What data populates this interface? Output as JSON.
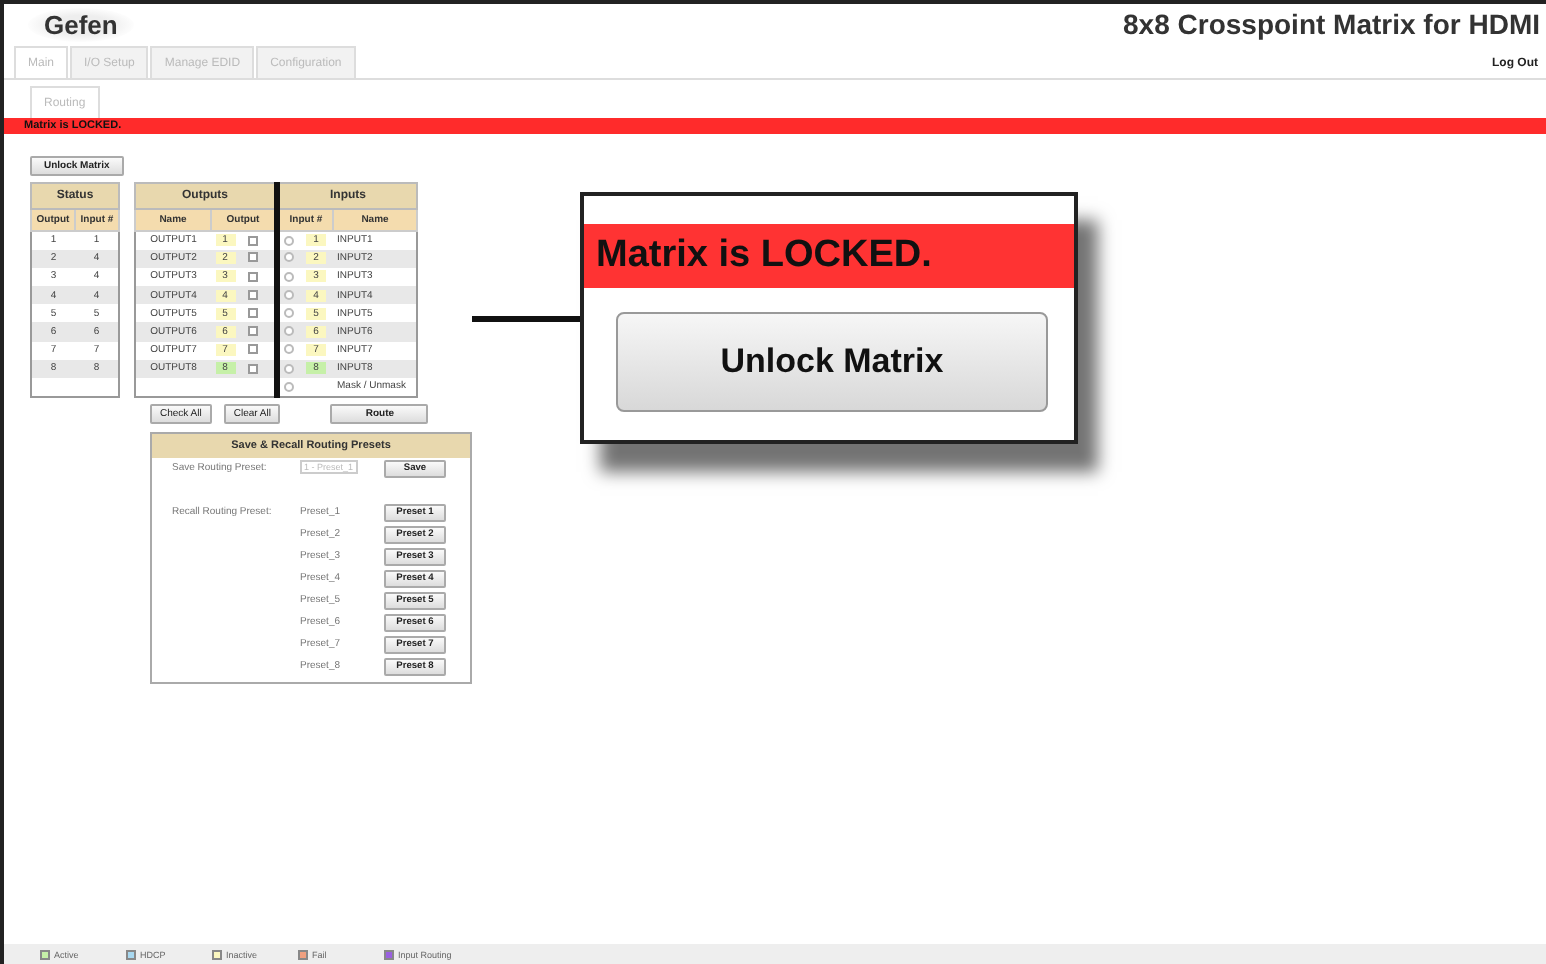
{
  "header": {
    "logo": "Gefen",
    "title": "8x8 Crosspoint Matrix for HDMI",
    "logout": "Log Out"
  },
  "tabs": [
    {
      "label": "Main",
      "selected": true
    },
    {
      "label": "I/O Setup",
      "selected": false
    },
    {
      "label": "Manage EDID",
      "selected": false
    },
    {
      "label": "Configuration",
      "selected": false
    }
  ],
  "subtabs": [
    {
      "label": "Routing",
      "selected": true
    }
  ],
  "banner": "Matrix is LOCKED.",
  "unlock_button": "Unlock Matrix",
  "status": {
    "title": "Status",
    "columns": [
      "Output",
      "Input #"
    ],
    "rows": [
      {
        "output": "1",
        "input": "1"
      },
      {
        "output": "2",
        "input": "4"
      },
      {
        "output": "3",
        "input": "4"
      },
      {
        "output": "4",
        "input": "4"
      },
      {
        "output": "5",
        "input": "5"
      },
      {
        "output": "6",
        "input": "6"
      },
      {
        "output": "7",
        "input": "7"
      },
      {
        "output": "8",
        "input": "8"
      }
    ]
  },
  "routing": {
    "outputs_title": "Outputs",
    "inputs_title": "Inputs",
    "output_columns": [
      "Name",
      "Output"
    ],
    "input_columns": [
      "Input #",
      "Name"
    ],
    "outputs": [
      {
        "name": "OUTPUT1",
        "number": "1",
        "active": false,
        "checked": false
      },
      {
        "name": "OUTPUT2",
        "number": "2",
        "active": false,
        "checked": false
      },
      {
        "name": "OUTPUT3",
        "number": "3",
        "active": false,
        "checked": false
      },
      {
        "name": "OUTPUT4",
        "number": "4",
        "active": false,
        "checked": false
      },
      {
        "name": "OUTPUT5",
        "number": "5",
        "active": false,
        "checked": false
      },
      {
        "name": "OUTPUT6",
        "number": "6",
        "active": false,
        "checked": false
      },
      {
        "name": "OUTPUT7",
        "number": "7",
        "active": false,
        "checked": false
      },
      {
        "name": "OUTPUT8",
        "number": "8",
        "active": true,
        "checked": false
      }
    ],
    "inputs": [
      {
        "number": "1",
        "name": "INPUT1",
        "active": false,
        "selected": false
      },
      {
        "number": "2",
        "name": "INPUT2",
        "active": false,
        "selected": false
      },
      {
        "number": "3",
        "name": "INPUT3",
        "active": false,
        "selected": false
      },
      {
        "number": "4",
        "name": "INPUT4",
        "active": false,
        "selected": false
      },
      {
        "number": "5",
        "name": "INPUT5",
        "active": false,
        "selected": false
      },
      {
        "number": "6",
        "name": "INPUT6",
        "active": false,
        "selected": false
      },
      {
        "number": "7",
        "name": "INPUT7",
        "active": false,
        "selected": false
      },
      {
        "number": "8",
        "name": "INPUT8",
        "active": true,
        "selected": false
      }
    ],
    "mask": {
      "label": "Mask / Unmask",
      "selected": false
    },
    "buttons": [
      "Check All",
      "Clear All"
    ],
    "route_button": "Route"
  },
  "presets": {
    "title": "Save & Recall Routing Presets",
    "save_label": "Save Routing Preset:",
    "save_select": "1 - Preset_1",
    "save_button": "Save",
    "recall_label": "Recall Routing Preset:",
    "items": [
      {
        "name": "Preset_1",
        "button": "Preset 1"
      },
      {
        "name": "Preset_2",
        "button": "Preset 2"
      },
      {
        "name": "Preset_3",
        "button": "Preset 3"
      },
      {
        "name": "Preset_4",
        "button": "Preset 4"
      },
      {
        "name": "Preset_5",
        "button": "Preset 5"
      },
      {
        "name": "Preset_6",
        "button": "Preset 6"
      },
      {
        "name": "Preset_7",
        "button": "Preset 7"
      },
      {
        "name": "Preset_8",
        "button": "Preset 8"
      }
    ]
  },
  "legend": [
    {
      "label": "Active",
      "color": "#c6f0a8"
    },
    {
      "label": "HDCP",
      "color": "#a8d8f0"
    },
    {
      "label": "Inactive",
      "color": "#fbf7c0"
    },
    {
      "label": "Fail",
      "color": "#f0a080"
    },
    {
      "label": "Input Routing",
      "color": "#9a60e0"
    }
  ],
  "callout": {
    "banner": "Matrix is LOCKED.",
    "button": "Unlock Matrix"
  }
}
